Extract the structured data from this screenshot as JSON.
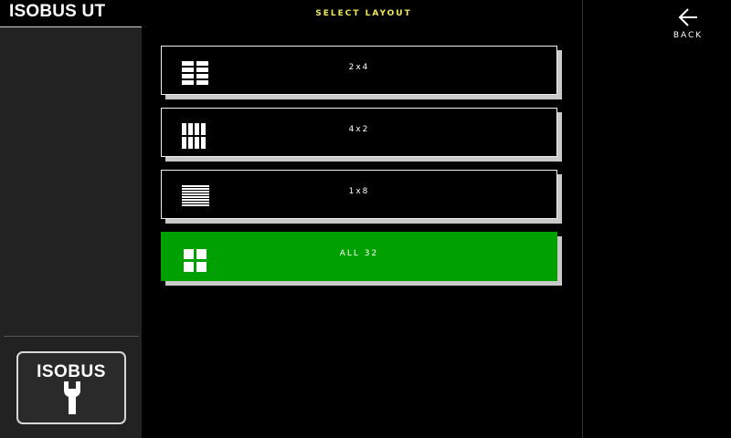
{
  "app": {
    "title": "ISOBUS UT"
  },
  "header": {
    "title": "SELECT LAYOUT"
  },
  "nav": {
    "back_label": "BACK"
  },
  "sidebar": {
    "isobus_label": "ISOBUS"
  },
  "layouts": [
    {
      "label": "2x4",
      "icon": "grid-2x4-icon",
      "selected": false
    },
    {
      "label": "4x2",
      "icon": "grid-4x2-icon",
      "selected": false
    },
    {
      "label": "1x8",
      "icon": "lines-1x8-icon",
      "selected": false
    },
    {
      "label": "ALL 32",
      "icon": "grid-all-icon",
      "selected": true
    }
  ],
  "colors": {
    "selected": "#00a000",
    "title": "#f2e85a",
    "shadow": "#c9c9c9"
  }
}
